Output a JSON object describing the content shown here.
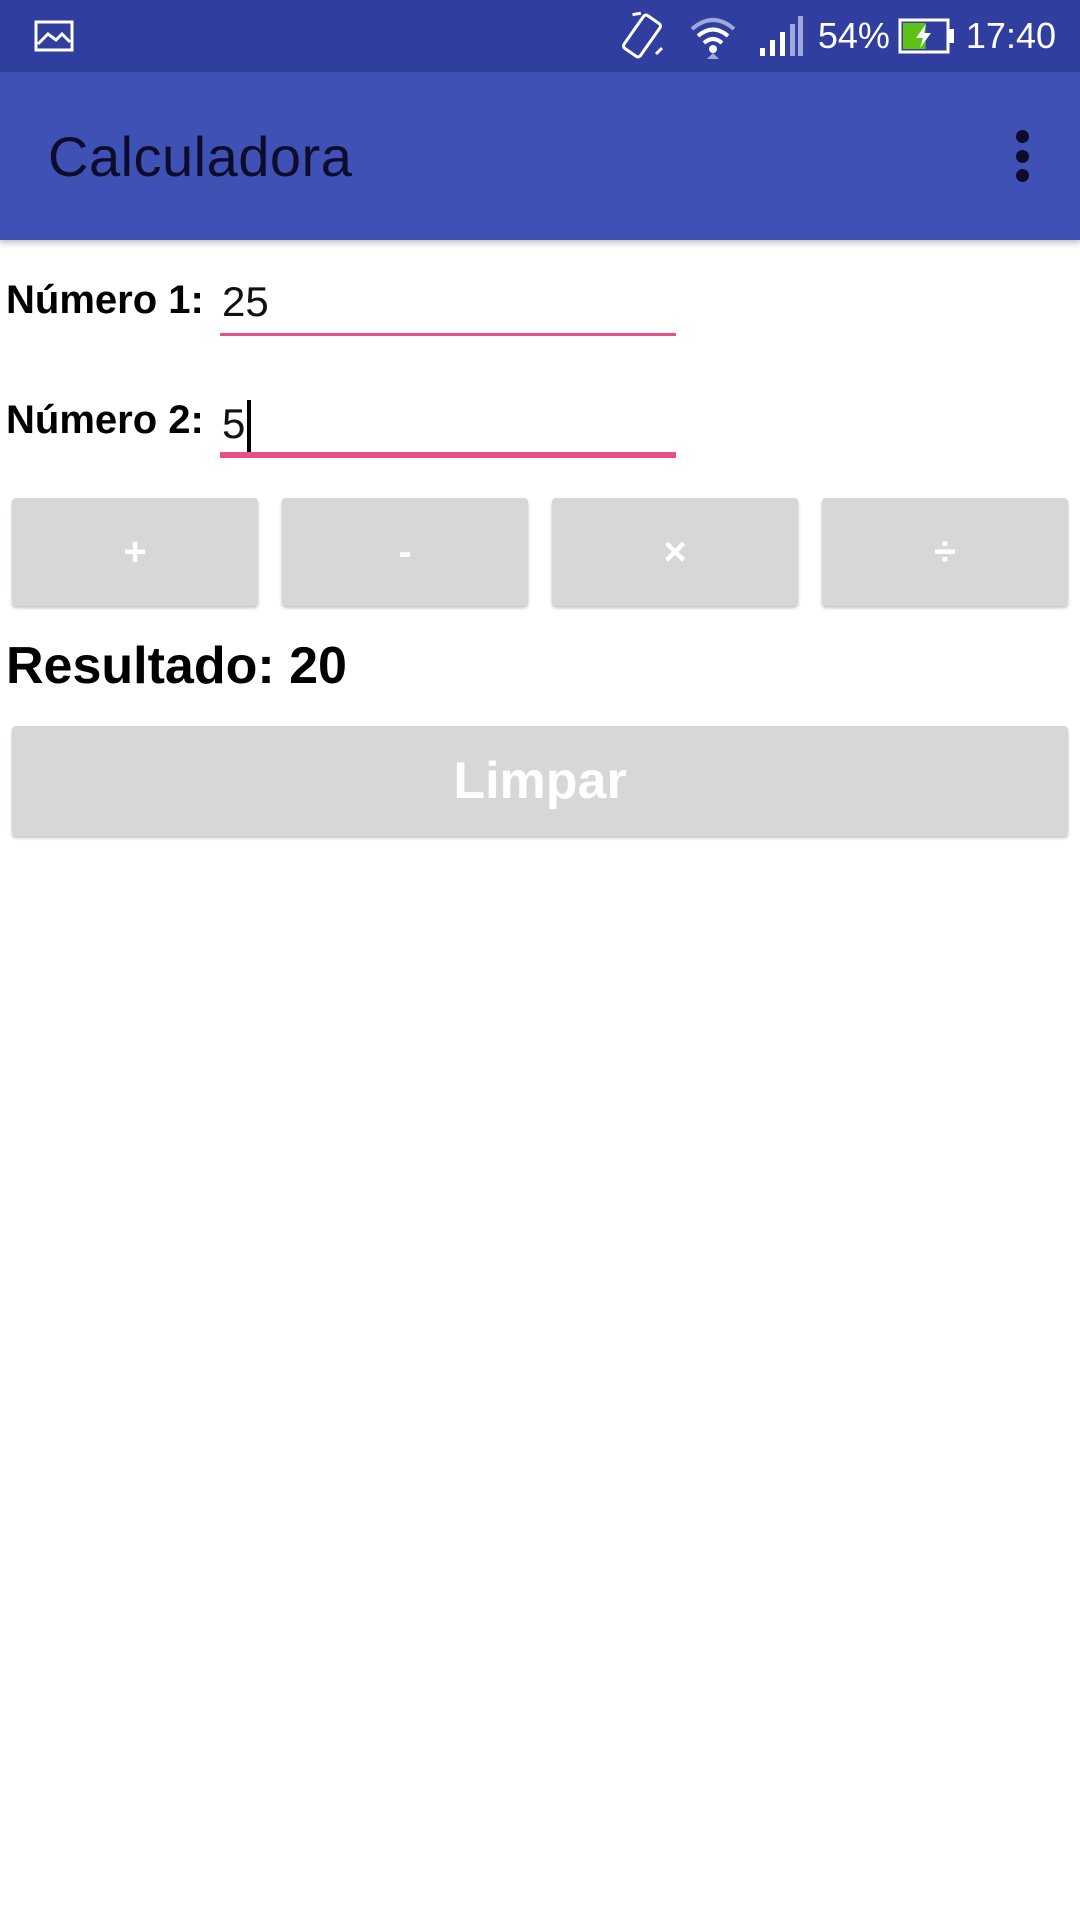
{
  "status_bar": {
    "left_icon": "image-icon",
    "vibrate_icon": "vibrate-icon",
    "wifi_icon": "wifi-icon",
    "signal_icon": "signal-icon",
    "battery_percent": "54%",
    "battery_icon": "battery-charging-icon",
    "battery_level": 0.54,
    "time": "17:40"
  },
  "app_bar": {
    "title": "Calculadora",
    "menu_icon": "overflow-menu-icon"
  },
  "form": {
    "number1": {
      "label": "Número 1:",
      "value": "25"
    },
    "number2": {
      "label": "Número 2:",
      "value": "5"
    }
  },
  "operations": [
    {
      "label": "+"
    },
    {
      "label": "-"
    },
    {
      "label": "×"
    },
    {
      "label": "÷"
    }
  ],
  "result": {
    "text": "Resultado: 20"
  },
  "clear_button": {
    "label": "Limpar"
  },
  "colors": {
    "status_bar": "#303F9F",
    "app_bar": "#3F51B5",
    "accent": "#E64F87",
    "button": "#D6D7D7"
  }
}
